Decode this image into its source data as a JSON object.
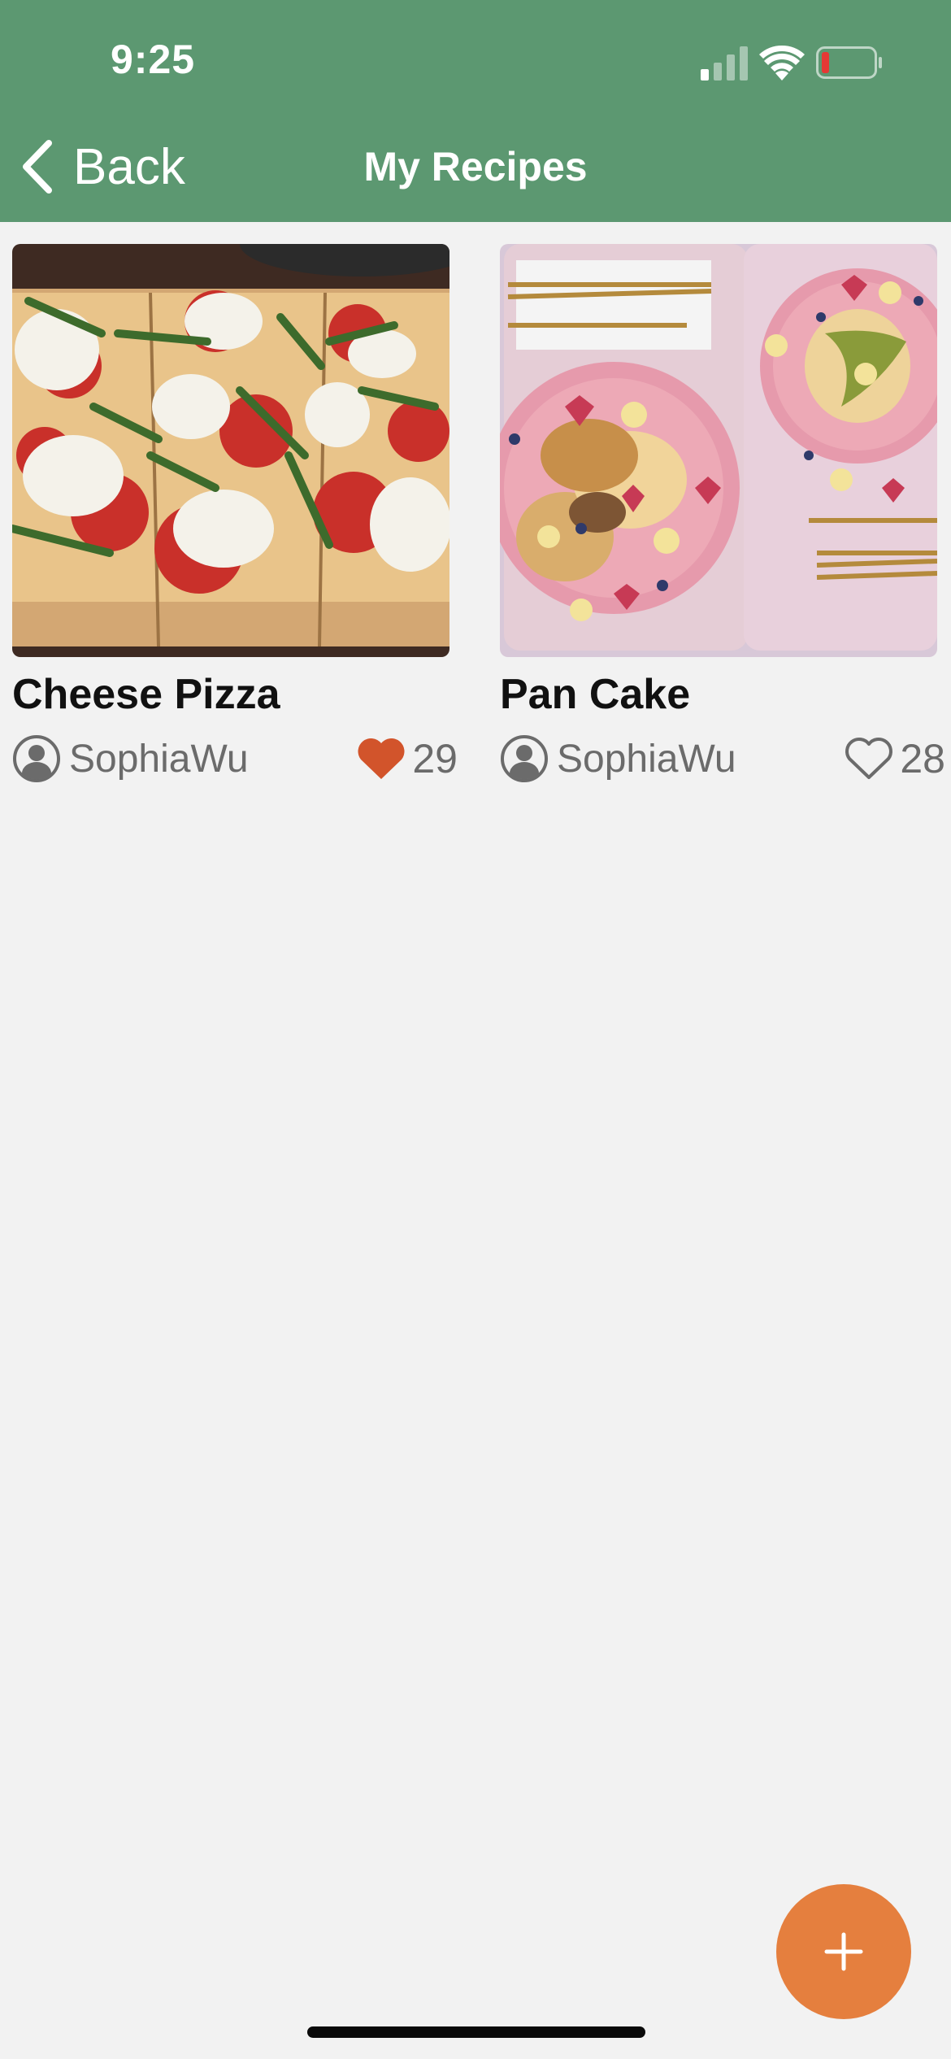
{
  "status_bar": {
    "time": "9:25"
  },
  "nav": {
    "back_label": "Back",
    "title": "My Recipes"
  },
  "recipes": [
    {
      "name": "Cheese Pizza",
      "author": "SophiaWu",
      "likes": "29",
      "liked": true
    },
    {
      "name": "Pan Cake",
      "author": "SophiaWu",
      "likes": "28",
      "liked": false
    }
  ],
  "colors": {
    "header": "#5c9871",
    "background": "#f2f2f2",
    "accent": "#e57f3e",
    "like_active": "#d2542b"
  },
  "fab": {
    "icon": "plus-icon"
  }
}
